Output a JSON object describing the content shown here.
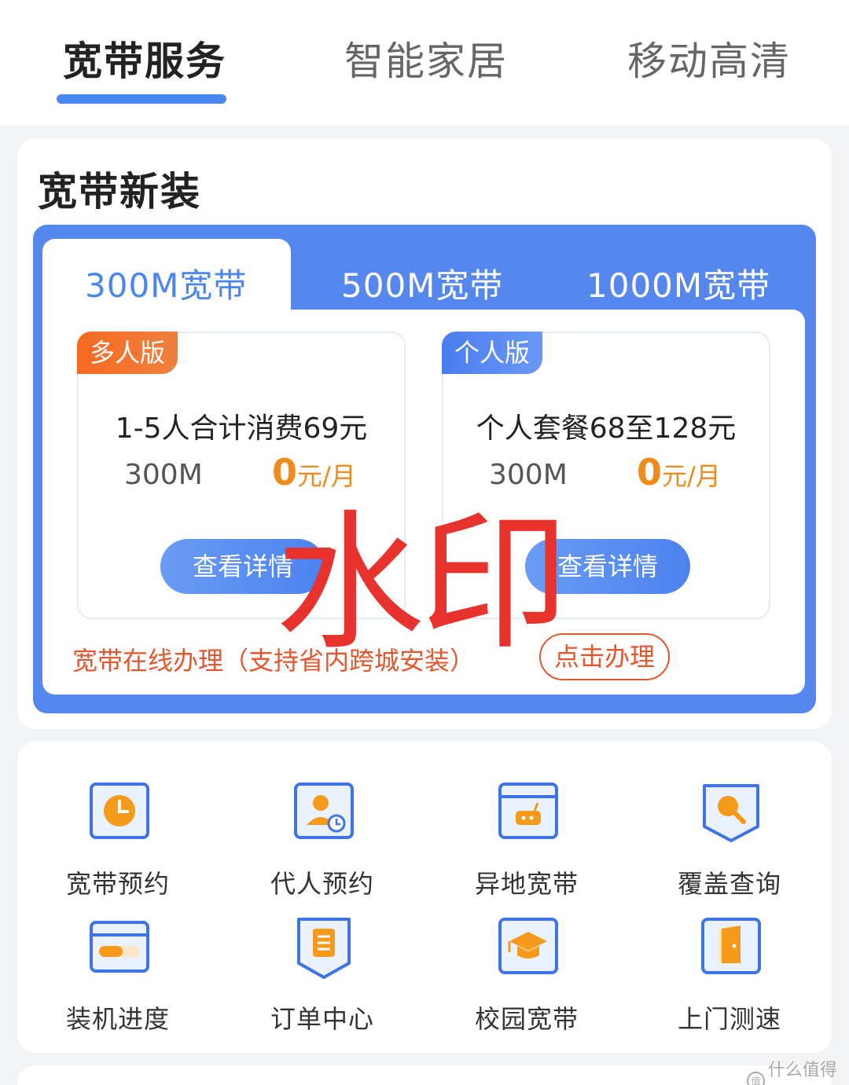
{
  "top_tabs": [
    {
      "label": "宽带服务",
      "active": true
    },
    {
      "label": "智能家居",
      "active": false
    },
    {
      "label": "移动高清",
      "active": false
    }
  ],
  "new_install": {
    "title": "宽带新装",
    "speed_tabs": [
      {
        "label": "300M宽带",
        "active": true
      },
      {
        "label": "500M宽带",
        "active": false
      },
      {
        "label": "1000M宽带",
        "active": false
      }
    ],
    "plans": [
      {
        "badge": "多人版",
        "desc": "1-5人合计消费69元",
        "speed": "300M",
        "price": "0",
        "unit": "元/月",
        "button": "查看详情"
      },
      {
        "badge": "个人版",
        "desc": "个人套餐68至128元",
        "speed": "300M",
        "price": "0",
        "unit": "元/月",
        "button": "查看详情"
      }
    ],
    "promo_text": "宽带在线办理（支持省内跨城安装）",
    "promo_button": "点击办理"
  },
  "watermark": "水印",
  "services": [
    {
      "label": "宽带预约",
      "icon": "clock-icon"
    },
    {
      "label": "代人预约",
      "icon": "person-clock-icon"
    },
    {
      "label": "异地宽带",
      "icon": "router-icon"
    },
    {
      "label": "覆盖查询",
      "icon": "search-icon"
    },
    {
      "label": "装机进度",
      "icon": "progress-card-icon"
    },
    {
      "label": "订单中心",
      "icon": "order-list-icon"
    },
    {
      "label": "校园宽带",
      "icon": "graduation-cap-icon"
    },
    {
      "label": "上门测速",
      "icon": "door-icon"
    }
  ],
  "brand": "什么值得买",
  "colors": {
    "accent": "#4a86f0",
    "orange": "#f08a1a",
    "promo": "#e4572e",
    "watermark": "#e8322e"
  }
}
